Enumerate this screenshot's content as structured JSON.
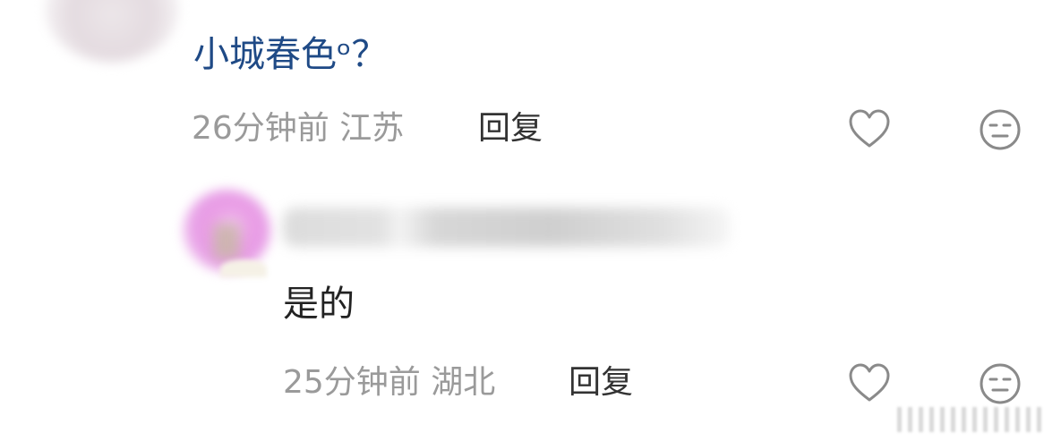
{
  "comment": {
    "text": "小城春色ᵒ？",
    "meta": "26分钟前 江苏",
    "reply_label": "回复",
    "like_icon": "heart-outline-icon",
    "reaction_icon": "neutral-face-icon"
  },
  "reply": {
    "text": "是的",
    "meta": "25分钟前 湖北",
    "reply_label": "回复",
    "like_icon": "heart-outline-icon",
    "reaction_icon": "neutral-face-icon"
  },
  "colors": {
    "comment_text": "#1f4a86",
    "meta_text": "#9a9a9a",
    "reply_link": "#333333",
    "avatar_pink": "#e79ee6"
  }
}
